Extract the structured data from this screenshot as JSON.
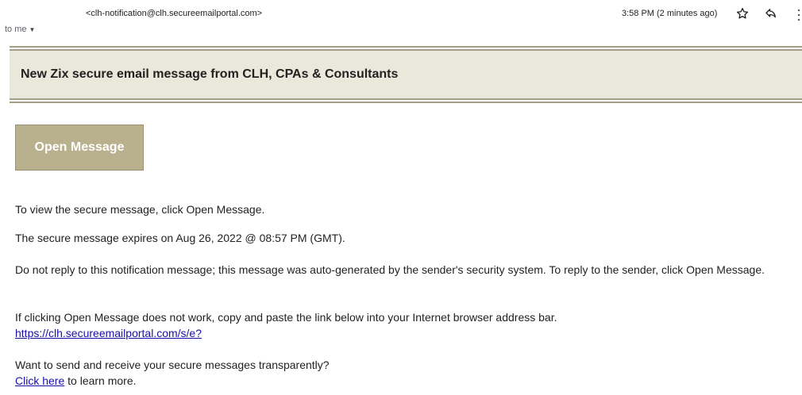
{
  "header": {
    "sender_email": "<clh-notification@clh.secureemailportal.com>",
    "to_me": "to me",
    "time": "3:58 PM (2 minutes ago)",
    "icons": [
      "star-icon",
      "reply-icon",
      "more-vert-icon"
    ]
  },
  "banner": {
    "title": "New Zix secure email message from CLH, CPAs & Consultants"
  },
  "open_button": {
    "label": "Open Message"
  },
  "body": {
    "p1": "To view the secure message, click Open Message.",
    "p2": "The secure message expires on Aug 26, 2022 @ 08:57 PM (GMT).",
    "p3": "Do not reply to this notification message; this message was auto-generated by the sender's security system. To reply to the sender, click Open Message.",
    "p4_text": "If clicking Open Message does not work, copy and paste the link below into your Internet browser address bar.",
    "p4_link": "https://clh.secureemailportal.com/s/e?",
    "p5_text": "Want to send and receive your secure messages transparently?",
    "p5_link": "Click here",
    "p5_suffix": " to learn more."
  },
  "colors": {
    "banner_bg": "#e9e8da",
    "rule": "#a59f87",
    "button_bg": "#b9b08e",
    "link": "#1a0dab"
  }
}
